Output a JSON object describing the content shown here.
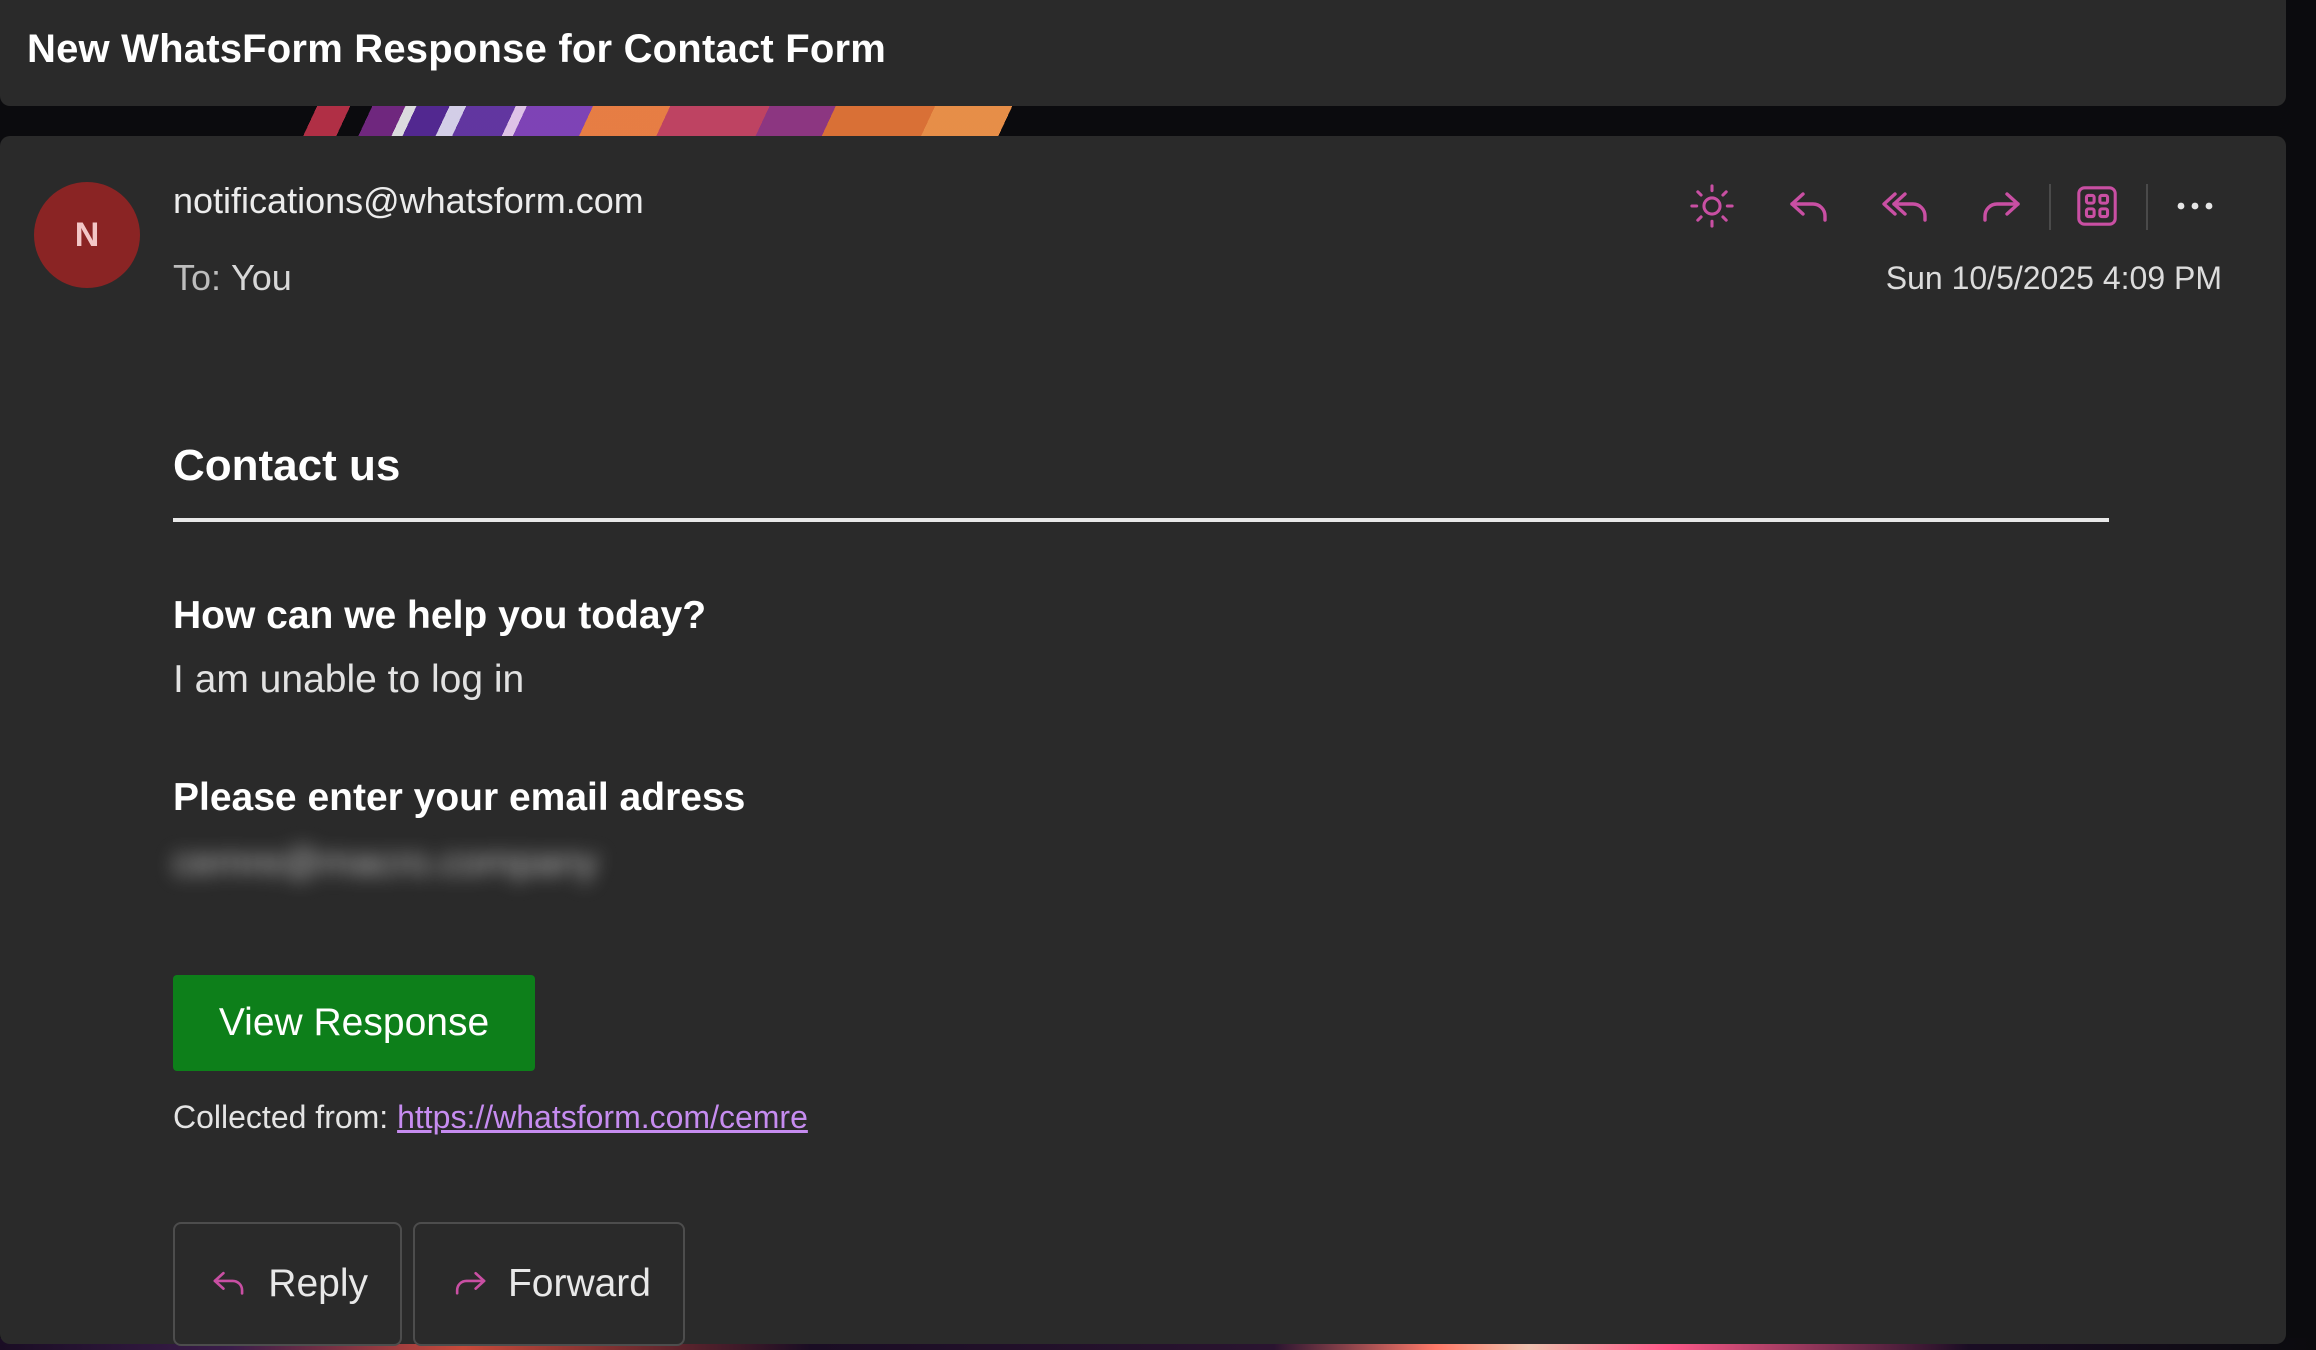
{
  "subject": "New WhatsForm Response for Contact Form",
  "message": {
    "avatar_initial": "N",
    "sender": "notifications@whatsform.com",
    "to_label": "To:",
    "to_value": "You",
    "date": "Sun 10/5/2025 4:09 PM"
  },
  "toolbar": {
    "icons": [
      "sun-icon",
      "reply-icon",
      "reply-all-icon",
      "forward-icon",
      "apps-icon",
      "more-icon"
    ],
    "accent_color": "#c94fa3"
  },
  "body": {
    "form_title": "Contact us",
    "questions": [
      {
        "label": "How can we help you today?",
        "answer": "I am unable to log in"
      },
      {
        "label": "Please enter your email adress",
        "answer": "cemre@macro.company"
      }
    ],
    "view_button": "View Response",
    "collected_label": "Collected from:",
    "collected_link": "https://whatsform.com/cemre"
  },
  "actions": {
    "reply_label": "Reply",
    "forward_label": "Forward"
  },
  "colors": {
    "background": "#2a2a2a",
    "avatar_bg": "#8a2424",
    "button_green": "#0d7f1a",
    "link": "#c68cf0"
  }
}
